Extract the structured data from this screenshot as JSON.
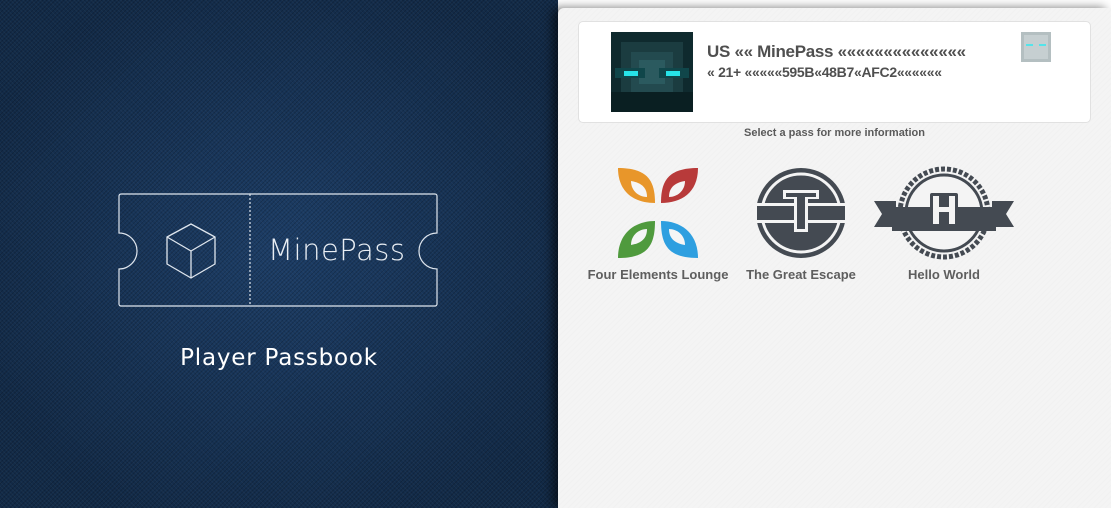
{
  "brand": {
    "ticket_name": "MinePass",
    "subtitle": "Player Passbook"
  },
  "active_pass": {
    "line1": "US «« MinePass ««««««««««««««",
    "line2": "« 21+ «««««595B«48B7«AFC2««««««"
  },
  "hint": "Select a pass for more information",
  "passes": [
    {
      "label": "Four Elements Lounge",
      "icon": "four-elements-logo"
    },
    {
      "label": "The Great Escape",
      "icon": "t-badge-logo"
    },
    {
      "label": "Hello World",
      "icon": "h-ribbon-logo"
    }
  ],
  "colors": {
    "left_bg": "#143052",
    "right_bg": "#f4f4f4",
    "avatar_eye": "#27e3e8",
    "badge_dark": "#444a52"
  }
}
